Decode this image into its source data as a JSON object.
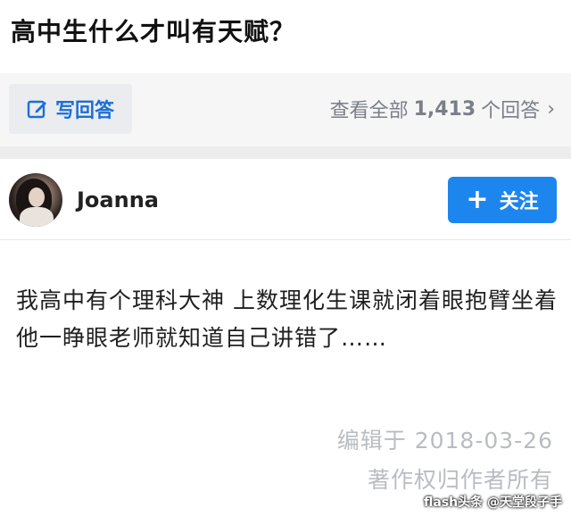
{
  "question": {
    "title": "高中生什么才叫有天赋？"
  },
  "actions": {
    "write_answer_label": "写回答",
    "view_all_prefix": "查看全部",
    "answer_count": "1,413",
    "view_all_suffix": "个回答",
    "chevron": "›"
  },
  "author": {
    "name": "Joanna",
    "follow_label": "关注",
    "follow_plus": "+"
  },
  "answer": {
    "text": "我高中有个理科大神 上数理化生课就闭着眼抱臂坐着 他一睁眼老师就知道自己讲错了……",
    "edited": "编辑于 2018-03-26",
    "copyright": "著作权归作者所有"
  },
  "watermark": "flash头条 @天堂段子手",
  "colors": {
    "accent_blue": "#1d86ee",
    "link_blue": "#1a6fd8",
    "muted_gray": "#b9bcc1",
    "bar_bg": "#f6f6f7"
  }
}
